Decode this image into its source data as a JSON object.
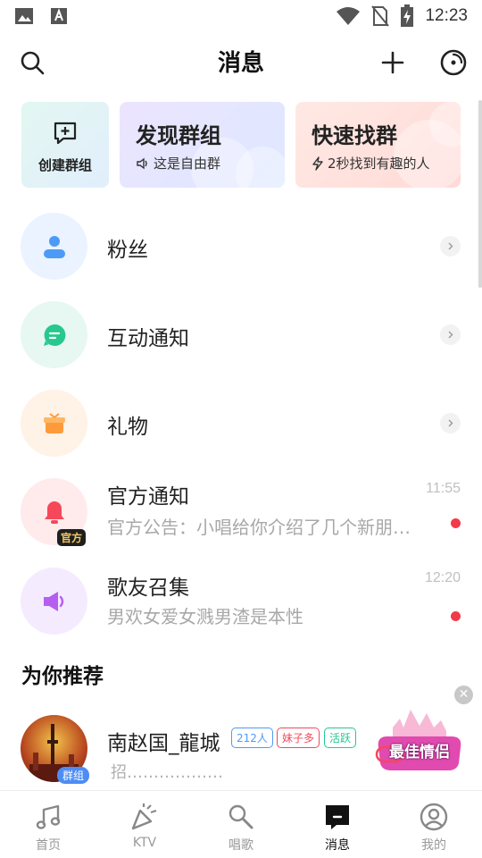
{
  "status_bar": {
    "time": "12:23",
    "icons": [
      "image-icon",
      "text-a-icon",
      "wifi-icon",
      "no-sim-icon",
      "battery-charging-icon"
    ]
  },
  "header": {
    "title": "消息",
    "icons": [
      "search-icon",
      "plus-icon",
      "music-disc-icon"
    ]
  },
  "cards": {
    "create": {
      "label": "创建群组",
      "icon": "chat-plus-icon"
    },
    "discover": {
      "title": "发现群组",
      "subtitle": "这是自由群",
      "icon": "speaker-icon"
    },
    "fast": {
      "title": "快速找群",
      "subtitle": "2秒找到有趣的人",
      "icon": "lightning-icon"
    }
  },
  "list": [
    {
      "name": "粉丝",
      "icon": "fans-icon",
      "color": "#4d9bf7"
    },
    {
      "name": "互动通知",
      "icon": "interaction-icon",
      "color": "#27c78e"
    },
    {
      "name": "礼物",
      "icon": "gift-icon",
      "color": "#ff9a3b"
    },
    {
      "name": "官方通知",
      "time": "11:55",
      "preview": "官方公告：小唱给你介绍了几个新朋…",
      "badge": "官方",
      "icon": "bell-icon",
      "color": "#f5485a"
    },
    {
      "name": "歌友召集",
      "time": "12:20",
      "preview": "男欢女爱女溅男渣是本性",
      "icon": "megaphone-icon",
      "color": "#b45ff2"
    }
  ],
  "recommend": {
    "title": "为你推荐",
    "group": {
      "name": "南赵国_龍城",
      "tag": "群组",
      "pills": [
        {
          "text": "212人",
          "color": "#4d9bf7"
        },
        {
          "text": "妹子多",
          "color": "#f5485a"
        },
        {
          "text": "活跃",
          "color": "#27c78e"
        }
      ],
      "description": "招………………"
    },
    "promo": {
      "text": "最佳情侣"
    }
  },
  "bottom_nav": [
    {
      "label": "首页",
      "icon": "music-note-icon",
      "active": false
    },
    {
      "label": "KTV",
      "icon": "party-popper-icon",
      "active": false
    },
    {
      "label": "唱歌",
      "icon": "microphone-icon",
      "active": false
    },
    {
      "label": "消息",
      "icon": "message-icon",
      "active": true
    },
    {
      "label": "我的",
      "icon": "profile-icon",
      "active": false
    }
  ]
}
